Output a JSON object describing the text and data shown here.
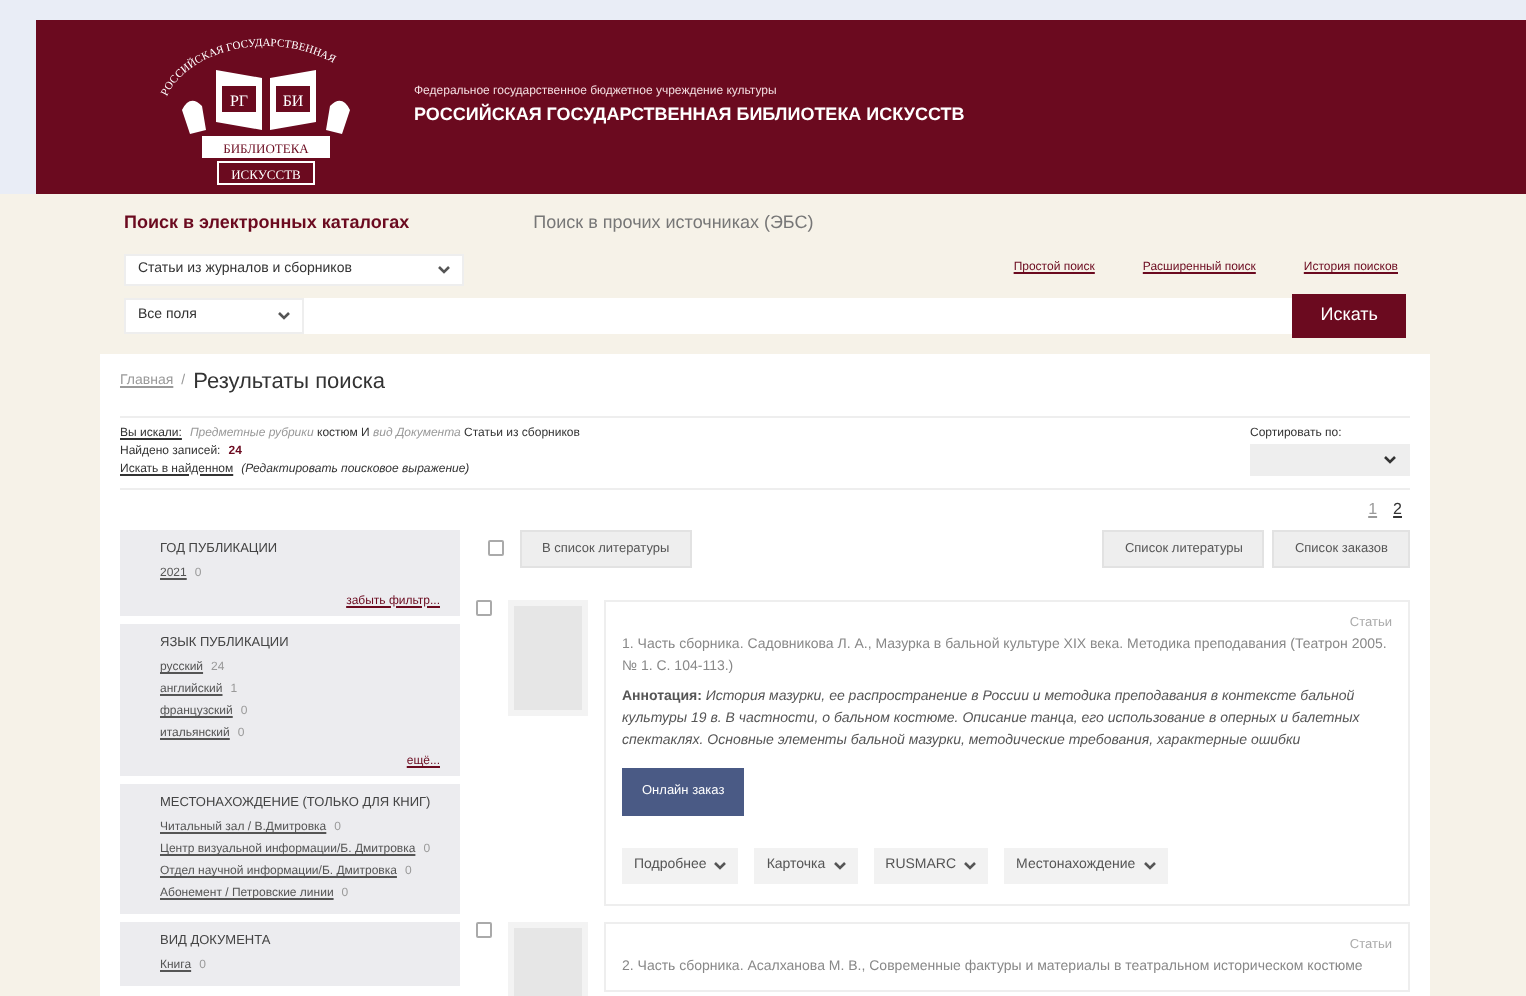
{
  "header": {
    "logo": {
      "arc": "РОССИЙСКАЯ ГОСУДАРСТВЕННАЯ",
      "left": "РГ",
      "right": "БИ",
      "ribbon": "БИБЛИОТЕКА",
      "base": "ИСКУССТВ"
    },
    "subtitle": "Федеральное государственное бюджетное учреждение культуры",
    "title": "РОССИЙСКАЯ ГОСУДАРСТВЕННАЯ БИБЛИОТЕКА ИСКУССТВ"
  },
  "search_tabs": [
    {
      "label": "Поиск в электронных каталогах",
      "selected": true
    },
    {
      "label": "Поиск в прочих источниках (ЭБС)",
      "selected": false
    }
  ],
  "search": {
    "catalog": "Статьи из журналов и сборников",
    "field": "Все поля",
    "links": [
      "Простой поиск",
      "Расширенный поиск",
      "История поисков"
    ],
    "button": "Искать"
  },
  "breadcrumb": {
    "home": "Главная",
    "separator": "/",
    "current": "Результаты поиска"
  },
  "query": {
    "label": "Вы искали:",
    "parts": [
      {
        "kind": "field",
        "text": "Предметные рубрики"
      },
      {
        "kind": "value",
        "text": "костюм И"
      },
      {
        "kind": "field",
        "text": "вид Документа"
      },
      {
        "kind": "value",
        "text": "Статьи из сборников"
      }
    ],
    "found_label": "Найдено записей:",
    "found": "24",
    "refine_link": "Искать в найденном",
    "refine_note": "(Редактировать поисковое выражение)",
    "sort_label": "Сортировать по:"
  },
  "pages": [
    {
      "label": "1",
      "selected": true
    },
    {
      "label": "2",
      "selected": false
    }
  ],
  "toolbar": {
    "checked": false,
    "add_button": "В список литературы",
    "buttons": [
      "Список литературы",
      "Список заказов"
    ]
  },
  "facets": [
    {
      "title": "ГОД ПУБЛИКАЦИИ",
      "items": [
        {
          "label": "2021",
          "count": "0"
        }
      ],
      "more": "забыть фильтр..."
    },
    {
      "title": "ЯЗЫК ПУБЛИКАЦИИ",
      "items": [
        {
          "label": "русский",
          "count": "24"
        },
        {
          "label": "английский",
          "count": "1"
        },
        {
          "label": "французский",
          "count": "0"
        },
        {
          "label": "итальянский",
          "count": "0"
        }
      ],
      "more": "ещё..."
    },
    {
      "title": "МЕСТОНАХОЖДЕНИЕ (ТОЛЬКО ДЛЯ КНИГ)",
      "items": [
        {
          "label": "Читальный зал / В.Дмитровка",
          "count": "0"
        },
        {
          "label": "Центр визуальной информации/Б. Дмитровка",
          "count": "0"
        },
        {
          "label": "Отдел научной информации/Б. Дмитровка",
          "count": "0"
        },
        {
          "label": "Абонемент / Петровские линии",
          "count": "0"
        }
      ]
    },
    {
      "title": "ВИД ДОКУМЕНТА",
      "items": [
        {
          "label": "Книга",
          "count": "0"
        }
      ]
    }
  ],
  "records": [
    {
      "checked": false,
      "type": "Статьи",
      "citation": "1. Часть сборника. Садовникова Л. А., Мазурка в бальной культуре XIX века. Методика преподавания (Театрон 2005. № 1. С. 104-113.)",
      "annotation_label": "Аннотация:",
      "annotation": "История мазурки, ее распространение в России и методика преподавания в контексте бальной культуры 19 в. В частности, о бальном костюме. Описание танца, его использование в оперных и балетных спектаклях. Основные элементы бальной мазурки, методические требования, характерные ошибки",
      "order_button": "Онлайн заказ",
      "menus": [
        "Подробнее",
        "Карточка",
        "RUSMARC",
        "Местонахождение"
      ]
    },
    {
      "checked": false,
      "type": "Статьи",
      "citation": "2. Часть сборника. Асалханова М. В., Современные фактуры и материалы в театральном историческом костюме"
    }
  ]
}
